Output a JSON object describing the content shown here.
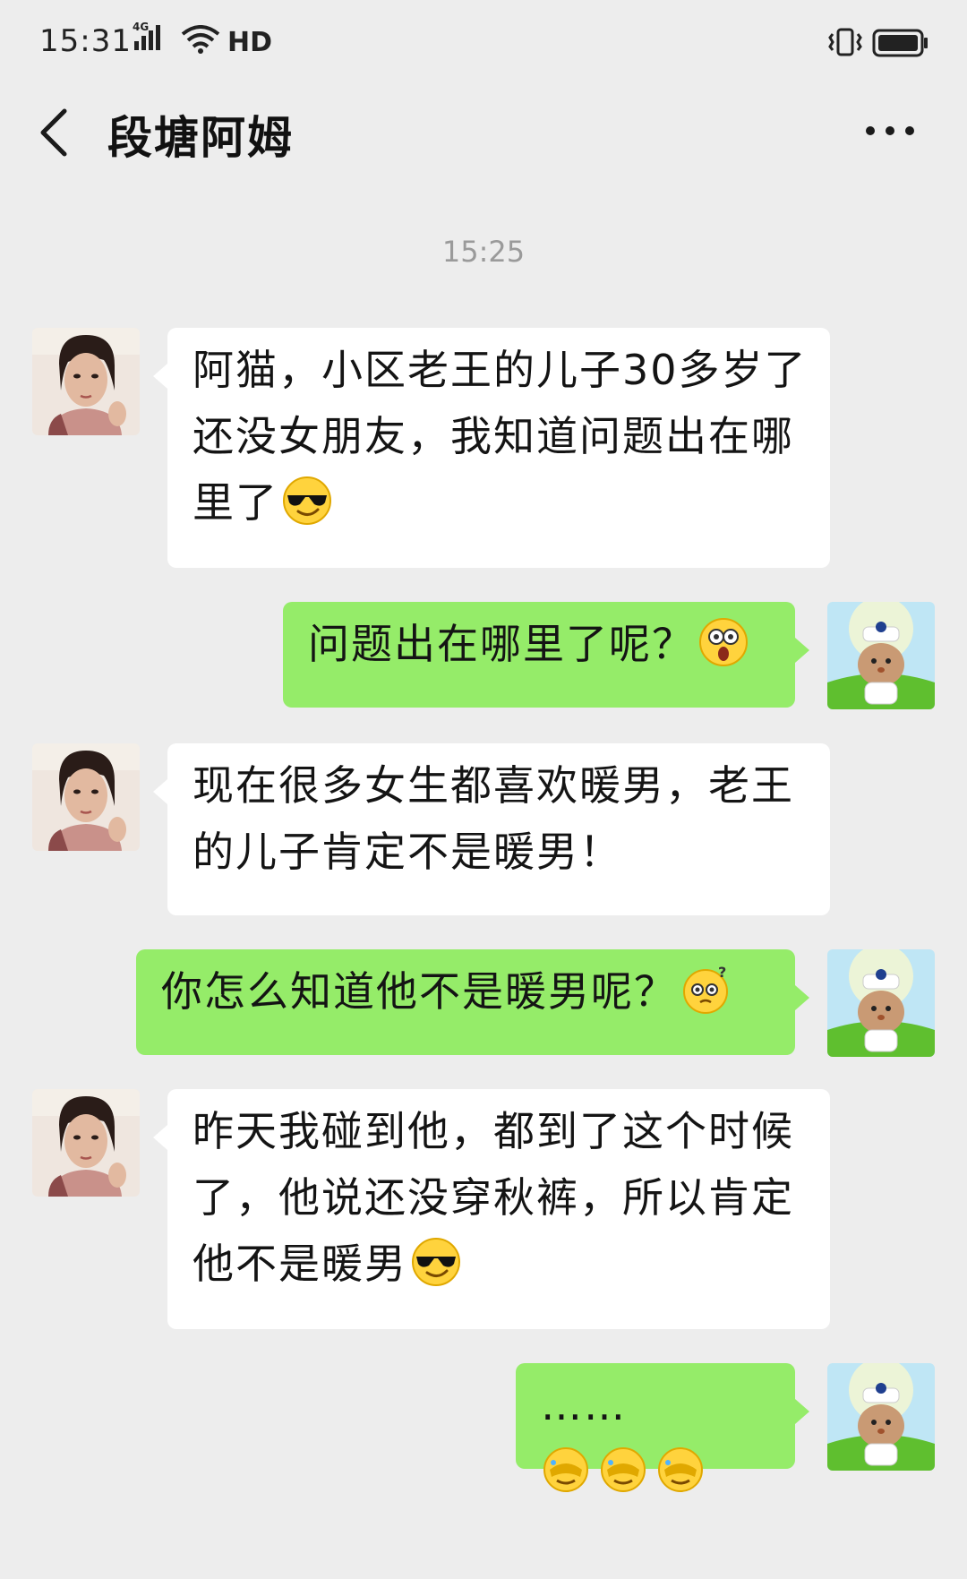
{
  "status_bar": {
    "time": "15:31",
    "network": "4G",
    "hd": "HD"
  },
  "header": {
    "title": "段塘阿姆"
  },
  "timestamp": "15:25",
  "messages": [
    {
      "from": "them",
      "text": "阿猫，小区老王的儿子30多岁了还没女朋友，我知道问题出在哪里了",
      "emoji": "cool-sunglasses"
    },
    {
      "from": "me",
      "text": "问题出在哪里了呢？",
      "emoji": "shocked-face"
    },
    {
      "from": "them",
      "text": "现在很多女生都喜欢暖男，老王的儿子肯定不是暖男！",
      "emoji": ""
    },
    {
      "from": "me",
      "text": "你怎么知道他不是暖男呢？",
      "emoji": "puzzled-face"
    },
    {
      "from": "them",
      "text": "昨天我碰到他，都到了这个时候了，他说还没穿秋裤，所以肯定他不是暖男",
      "emoji": "cool-sunglasses"
    },
    {
      "from": "me",
      "text": "……",
      "emoji": "facepalm-x3"
    }
  ],
  "colors": {
    "background": "#ededed",
    "outgoing_bubble": "#95ec69",
    "incoming_bubble": "#ffffff"
  }
}
